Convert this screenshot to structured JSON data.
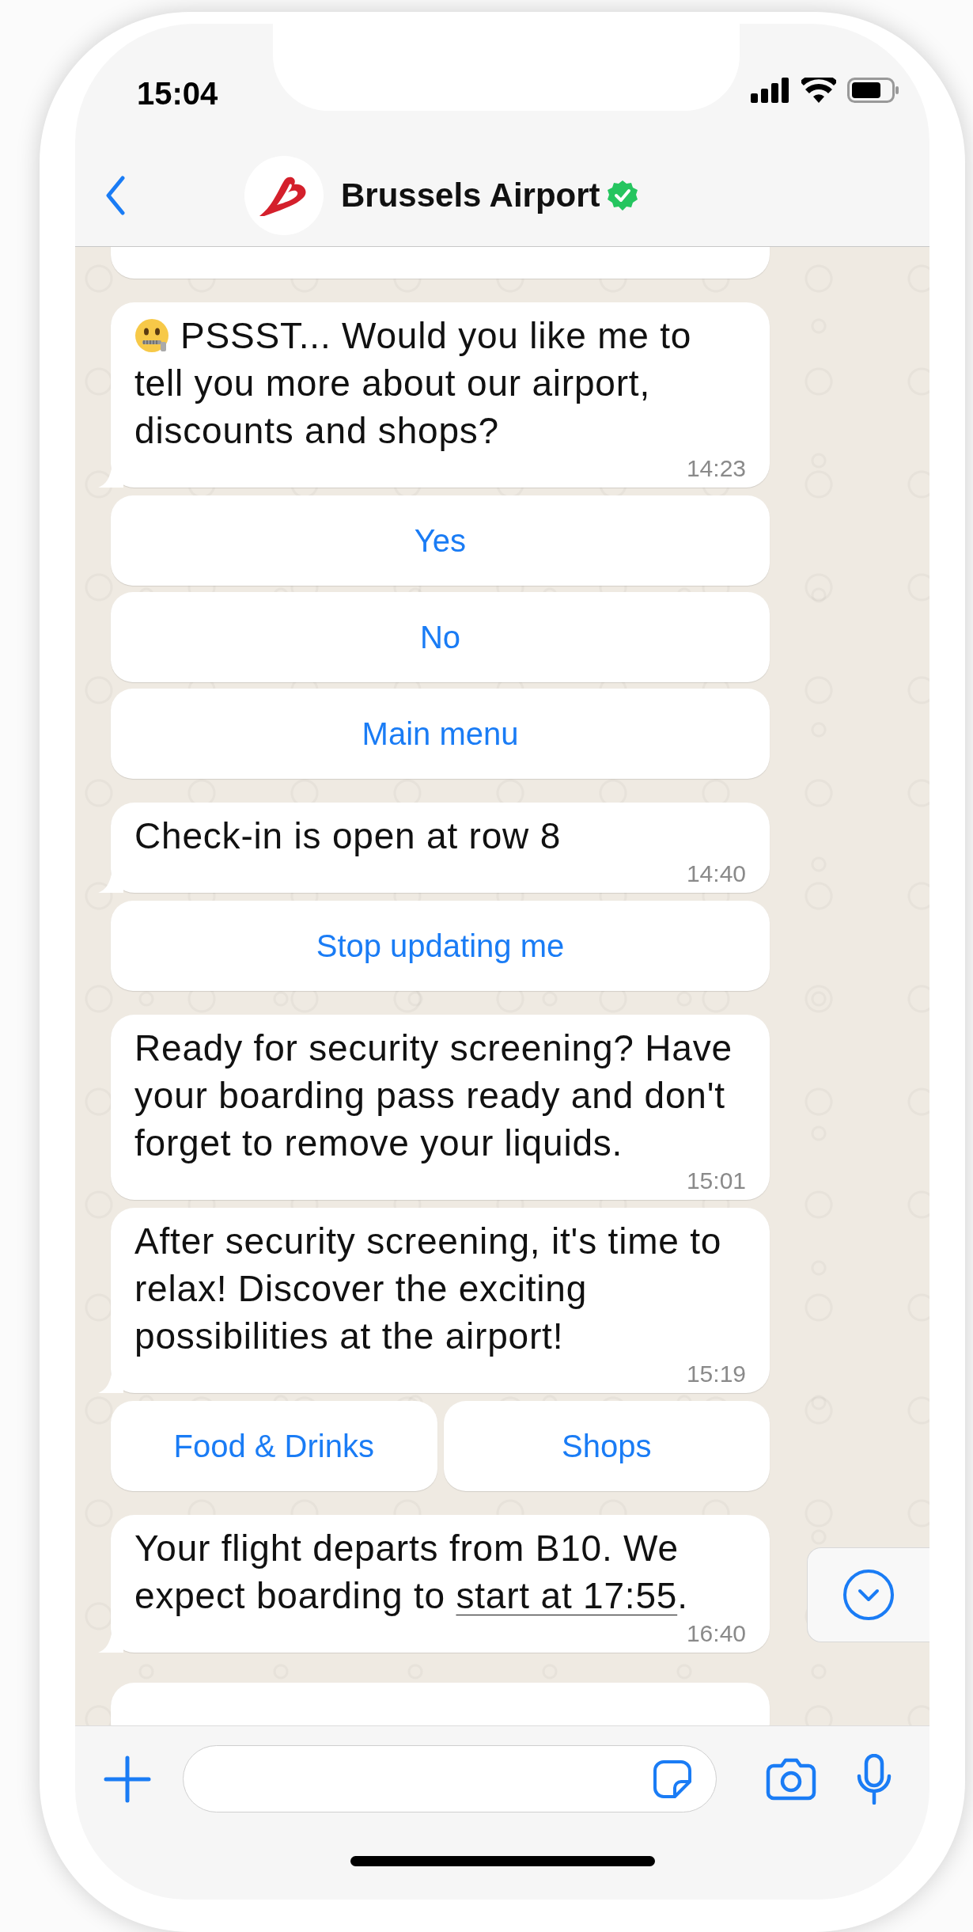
{
  "status_bar": {
    "time": "15:04"
  },
  "header": {
    "title": "Brussels Airport",
    "verified": true
  },
  "messages": [
    {
      "kind": "clipped"
    },
    {
      "kind": "message",
      "emoji": true,
      "text": "PSSST... Would you like me to tell you more about our airport, discounts and shops?",
      "time": "14:23",
      "tail": true
    },
    {
      "kind": "reply_stack",
      "buttons": [
        "Yes",
        "No",
        "Main menu"
      ]
    },
    {
      "kind": "message",
      "emoji": false,
      "text": "Check-in is open at row 8",
      "time": "14:40",
      "tail": true
    },
    {
      "kind": "reply_stack",
      "buttons": [
        "Stop updating me"
      ]
    },
    {
      "kind": "message",
      "emoji": false,
      "text": "Ready for security screening? Have your boarding pass ready and don't forget to remove your liquids.",
      "time": "15:01",
      "tail": false
    },
    {
      "kind": "message",
      "emoji": false,
      "text": "After security screening, it's time to relax! Discover the exciting possibilities at the airport!",
      "time": "15:19",
      "tail": true
    },
    {
      "kind": "reply_row",
      "buttons": [
        "Food & Drinks",
        "Shops"
      ]
    },
    {
      "kind": "message",
      "emoji": false,
      "text": "Your flight departs from B10. We expect boarding to ",
      "link": "start at 17:55",
      "text_after": ".",
      "time": "16:40",
      "tail": true
    },
    {
      "kind": "clipped"
    }
  ]
}
